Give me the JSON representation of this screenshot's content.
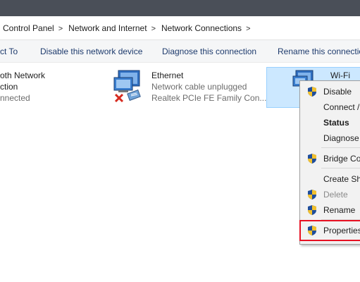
{
  "breadcrumb": {
    "items": [
      "Control Panel",
      "Network and Internet",
      "Network Connections"
    ],
    "separator": ">"
  },
  "toolbar": {
    "connect_label": "ct To",
    "disable_label": "Disable this network device",
    "diagnose_label": "Diagnose this connection",
    "rename_label": "Rename this connectio"
  },
  "connections": {
    "bluetooth": {
      "name_line1": "oth Network",
      "name_line2": "ction",
      "status": "nnected"
    },
    "ethernet": {
      "name": "Ethernet",
      "status": "Network cable unplugged",
      "device": "Realtek PCIe FE Family Con..."
    },
    "wifi": {
      "name": "Wi-Fi"
    }
  },
  "context_menu": {
    "disable": "Disable",
    "connect": "Connect /",
    "status": "Status",
    "diagnose": "Diagnose",
    "bridge": "Bridge Co",
    "create_shortcut": "Create Sh",
    "delete": "Delete",
    "rename": "Rename",
    "properties": "Properties"
  },
  "colors": {
    "titlebar": "#4a4f58",
    "selection": "#cce8ff",
    "highlight": "#e81123",
    "toolbar_text": "#1e3b6d"
  }
}
